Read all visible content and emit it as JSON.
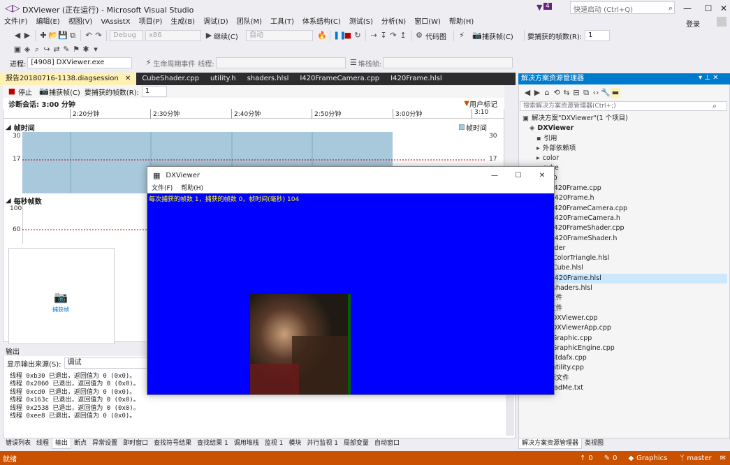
{
  "window": {
    "title": "DXViewer (正在运行) - Microsoft Visual Studio",
    "notification_count": "4",
    "quick_launch_placeholder": "快速启动 (Ctrl+Q)",
    "sign_in": "登录"
  },
  "menu": [
    "文件(F)",
    "编辑(E)",
    "视图(V)",
    "VAssistX",
    "项目(P)",
    "生成(B)",
    "调试(D)",
    "团队(M)",
    "工具(T)",
    "体系结构(C)",
    "测试(S)",
    "分析(N)",
    "窗口(W)",
    "帮助(H)"
  ],
  "toolbar": {
    "config": "Debug",
    "platform": "x86",
    "continue": "继续(C)",
    "auto": "自动",
    "code_map": "代码图",
    "capture_frame": "捕获帧(C)",
    "frames_to_capture_label": "要捕获的帧数(R):",
    "frames_to_capture_value": "1"
  },
  "debug_toolbar": {
    "process_label": "进程:",
    "process_value": "[4908] DXViewer.exe",
    "lifecycle_label": "生命周期事件",
    "thread_label": "线程:",
    "stackframe_label": "堆栈帧:"
  },
  "doc_tabs": [
    {
      "label": "报告20180716-1138.diagsession",
      "active": true
    },
    {
      "label": "CubeShader.cpp",
      "active": false
    },
    {
      "label": "utility.h",
      "active": false
    },
    {
      "label": "shaders.hlsl",
      "active": false
    },
    {
      "label": "I420FrameCamera.cpp",
      "active": false
    },
    {
      "label": "I420Frame.hlsl",
      "active": false
    }
  ],
  "diag": {
    "stop_label": "停止",
    "capture_label": "捕获帧(C)",
    "frames_label": "要捕获的帧数(R):",
    "frames_value": "1",
    "session_label": "诊断会话: 3:00 分钟",
    "user_marker": "用户标记",
    "ticks": [
      "2:20分钟",
      "2:30分钟",
      "2:40分钟",
      "2:50分钟",
      "3:00分钟",
      "3:10"
    ],
    "frametime_title": "帧时间",
    "frametime_legend": "帧时间",
    "frametime_axis": [
      "30",
      "17"
    ],
    "fps_title": "每秒帧数",
    "fps_axis": [
      "100",
      "60"
    ],
    "capture_card_label": "捕获帧"
  },
  "output": {
    "title": "输出",
    "source_label": "显示输出来源(S):",
    "source_value": "调试",
    "lines": [
      "线程 0xb30 已退出，返回值为 0 (0x0)。",
      "线程 0x2060 已退出，返回值为 0 (0x0)。",
      "线程 0xcd0 已退出，返回值为 0 (0x0)。",
      "线程 0x163c 已退出，返回值为 0 (0x0)。",
      "线程 0x2538 已退出，返回值为 0 (0x0)。",
      "线程 0xee8 已退出，返回值为 0 (0x0)。"
    ]
  },
  "bottom_tabs": [
    {
      "label": "错误列表",
      "active": false
    },
    {
      "label": "线程",
      "active": false
    },
    {
      "label": "输出",
      "active": true
    },
    {
      "label": "断点",
      "active": false
    },
    {
      "label": "异常设置",
      "active": false
    },
    {
      "label": "即时窗口",
      "active": false
    },
    {
      "label": "查找符号结果",
      "active": false
    },
    {
      "label": "查找结果 1",
      "active": false
    },
    {
      "label": "调用堆栈",
      "active": false
    },
    {
      "label": "监视 1",
      "active": false
    },
    {
      "label": "模块",
      "active": false
    },
    {
      "label": "并行监视 1",
      "active": false
    },
    {
      "label": "局部变量",
      "active": false
    },
    {
      "label": "自动窗口",
      "active": false
    }
  ],
  "statusbar": {
    "ready": "就绪",
    "up_count": "0",
    "edit_count": "0",
    "repo": "Graphics",
    "branch": "master"
  },
  "solution_explorer": {
    "title": "解决方案资源管理器",
    "search_placeholder": "搜索解决方案资源管理器(Ctrl+;)",
    "tree": [
      {
        "label": "解决方案\"DXViewer\"(1 个项目)",
        "indent": 0,
        "icon": "solution-icon"
      },
      {
        "label": "DXViewer",
        "indent": 1,
        "icon": "project-icon",
        "bold": true
      },
      {
        "label": "引用",
        "indent": 2,
        "icon": "references-icon"
      },
      {
        "label": "外部依赖项",
        "indent": 2,
        "icon": "folder-icon"
      },
      {
        "label": "color",
        "indent": 2,
        "icon": "folder-icon"
      },
      {
        "label": "cube",
        "indent": 2,
        "icon": "folder-icon"
      },
      {
        "label": "I420",
        "indent": 2,
        "icon": "folder-icon"
      },
      {
        "label": "I420Frame.cpp",
        "indent": 3,
        "icon": "cpp-file-icon"
      },
      {
        "label": "I420Frame.h",
        "indent": 3,
        "icon": "h-file-icon"
      },
      {
        "label": "I420FrameCamera.cpp",
        "indent": 3,
        "icon": "cpp-file-icon"
      },
      {
        "label": "I420FrameCamera.h",
        "indent": 3,
        "icon": "h-file-icon"
      },
      {
        "label": "I420FrameShader.cpp",
        "indent": 3,
        "icon": "cpp-file-icon"
      },
      {
        "label": "I420FrameShader.h",
        "indent": 3,
        "icon": "h-file-icon"
      },
      {
        "label": "shader",
        "indent": 2,
        "icon": "folder-icon"
      },
      {
        "label": "ColorTriangle.hlsl",
        "indent": 3,
        "icon": "hlsl-file-icon"
      },
      {
        "label": "Cube.hlsl",
        "indent": 3,
        "icon": "hlsl-file-icon"
      },
      {
        "label": "I420Frame.hlsl",
        "indent": 3,
        "icon": "hlsl-file-icon",
        "selected": true
      },
      {
        "label": "shaders.hlsl",
        "indent": 3,
        "icon": "hlsl-file-icon"
      },
      {
        "label": "头文件",
        "indent": 2,
        "icon": "folder-icon"
      },
      {
        "label": "源文件",
        "indent": 2,
        "icon": "folder-icon"
      },
      {
        "label": "DXViewer.cpp",
        "indent": 3,
        "icon": "cpp-file-icon"
      },
      {
        "label": "DXViewerApp.cpp",
        "indent": 3,
        "icon": "cpp-file-icon"
      },
      {
        "label": "Graphic.cpp",
        "indent": 3,
        "icon": "cpp-file-icon"
      },
      {
        "label": "GraphicEngine.cpp",
        "indent": 3,
        "icon": "cpp-file-icon"
      },
      {
        "label": "stdafx.cpp",
        "indent": 3,
        "icon": "cpp-file-icon"
      },
      {
        "label": "utility.cpp",
        "indent": 3,
        "icon": "cpp-file-icon"
      },
      {
        "label": "资源文件",
        "indent": 2,
        "icon": "folder-icon"
      },
      {
        "label": "ReadMe.txt",
        "indent": 2,
        "icon": "txt-file-icon"
      }
    ],
    "bottom_tabs": [
      "解决方案资源管理器",
      "类视图"
    ]
  },
  "dxviewer": {
    "title": "DXViewer",
    "menu": [
      "文件(F)",
      "帮助(H)"
    ],
    "overlay": "每次捕获的帧数 1，捕获的帧数 0，帧时间(毫秒) 104",
    "background": "#0000ff"
  },
  "colors": {
    "accent": "#007acc",
    "statusbar": "#ca5100",
    "chart_fill": "#a8c8dc",
    "redline": "#c00000"
  }
}
